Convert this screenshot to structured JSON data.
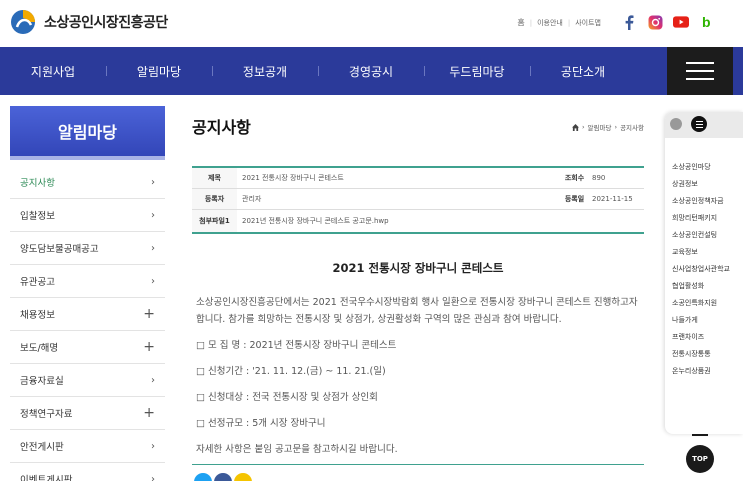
{
  "header": {
    "logo_text": "소상공인시장진흥공단",
    "util": {
      "home": "홈",
      "guide": "이용안내",
      "sitemap": "사이트맵"
    },
    "social": [
      "facebook-icon",
      "instagram-icon",
      "youtube-icon",
      "blog-icon"
    ]
  },
  "nav": {
    "items": [
      "지원사업",
      "알림마당",
      "정보공개",
      "경영공시",
      "두드림마당",
      "공단소개"
    ]
  },
  "sidebar": {
    "title": "알림마당",
    "items": [
      {
        "label": "공지사항",
        "marker": "›"
      },
      {
        "label": "입찰정보",
        "marker": "›"
      },
      {
        "label": "양도담보물공매공고",
        "marker": "›"
      },
      {
        "label": "유관공고",
        "marker": "›"
      },
      {
        "label": "채용정보",
        "marker": "+"
      },
      {
        "label": "보도/해명",
        "marker": "+"
      },
      {
        "label": "금융자료실",
        "marker": "›"
      },
      {
        "label": "정책연구자료",
        "marker": "+"
      },
      {
        "label": "안전게시판",
        "marker": "›"
      },
      {
        "label": "이벤트게시판",
        "marker": "›"
      }
    ]
  },
  "main": {
    "page_title": "공지사항",
    "breadcrumb": {
      "level1": "알림마당",
      "level2": "공지사항"
    },
    "info": {
      "title_label": "제목",
      "title_value": "2021 전통시장 장바구니 콘테스트",
      "views_label": "조회수",
      "views_value": "890",
      "writer_label": "등록자",
      "writer_value": "관리자",
      "date_label": "등록일",
      "date_value": "2021-11-15",
      "file_label": "첨부파일1",
      "file_value": "2021년 전통시장 장바구니 콘테스트 공고문.hwp"
    },
    "post_title": "2021 전통시장 장바구니 콘테스트",
    "body": [
      "소상공인시장진흥공단에서는 2021 전국우수시장박람회 행사 일환으로 전통시장 장바구니 콘테스트 진행하고자 합니다. 참가를 희망하는 전통시장 및 상점가, 상권활성화 구역의 많은 관심과 참여 바랍니다.",
      "□ 모 집 명 : 2021년 전통시장 장바구니 콘테스트",
      "□ 신청기간 : '21. 11. 12.(금) ~ 11. 21.(일)",
      "□ 신청대상 : 전국 전통시장 및 상점가 상인회",
      "□ 선정규모 : 5개 시장 장바구니",
      "자세한 사항은 붙임 공고문을 참고하시길 바랍니다."
    ]
  },
  "quick": {
    "items": [
      "소상공인마당",
      "상권정보",
      "소상공인정책자금",
      "희망리턴패키지",
      "소상공인컨설팅",
      "교육정보",
      "신사업창업사관학교",
      "협업활성화",
      "소공인특화지원",
      "나들가게",
      "프랜차이즈",
      "전통시장통통",
      "온누리상품권"
    ],
    "top_label": "TOP"
  }
}
